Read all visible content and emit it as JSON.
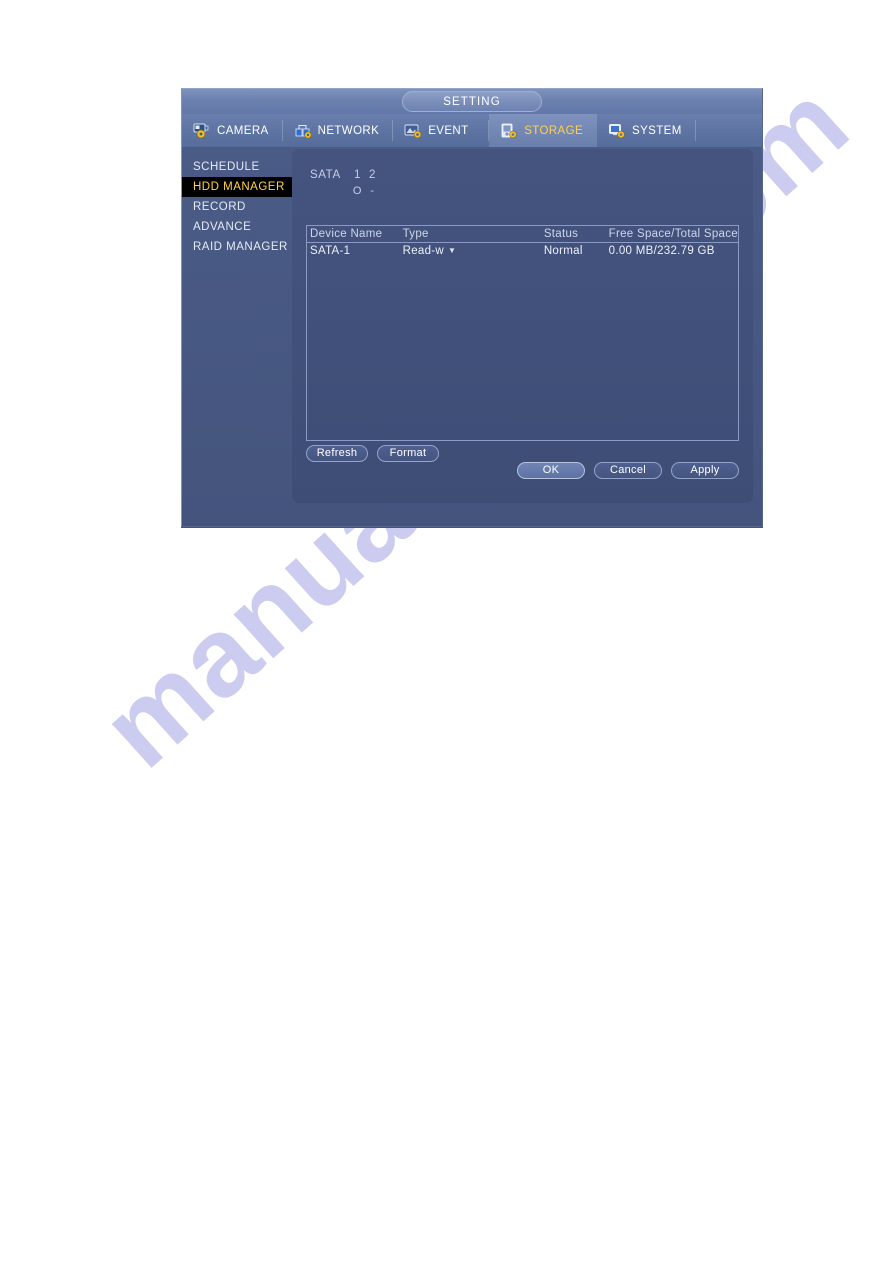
{
  "page": {
    "watermark": "manualshive.com",
    "background_color": "#ffffff",
    "watermark_color": "#c9caf0"
  },
  "dialog": {
    "title": "SETTING",
    "accent_color": "#ffd24d",
    "panel_color": "#3f4f79",
    "chrome_color": "#495a85"
  },
  "tabs": [
    {
      "label": "CAMERA",
      "icon": "camera-gear-icon",
      "active": false
    },
    {
      "label": "NETWORK",
      "icon": "network-gear-icon",
      "active": false
    },
    {
      "label": "EVENT",
      "icon": "event-gear-icon",
      "active": false
    },
    {
      "label": "STORAGE",
      "icon": "storage-gear-icon",
      "active": true
    },
    {
      "label": "SYSTEM",
      "icon": "system-gear-icon",
      "active": false
    }
  ],
  "sidebar": {
    "items": [
      {
        "label": "SCHEDULE",
        "active": false
      },
      {
        "label": "HDD MANAGER",
        "active": true
      },
      {
        "label": "RECORD",
        "active": false
      },
      {
        "label": "ADVANCE",
        "active": false
      },
      {
        "label": "RAID MANAGER",
        "active": false
      }
    ]
  },
  "sata": {
    "label": "SATA",
    "slots": [
      "1",
      "2"
    ],
    "states": [
      "O",
      "-"
    ]
  },
  "table": {
    "headers": [
      "Device Name",
      "Type",
      "Status",
      "Free Space/Total Space"
    ],
    "rows": [
      {
        "device_name": "SATA-1",
        "type": "Read-w",
        "type_caret": "▼",
        "status": "Normal",
        "space": "0.00 MB/232.79 GB"
      }
    ]
  },
  "buttons": {
    "refresh": "Refresh",
    "format": "Format",
    "ok": "OK",
    "cancel": "Cancel",
    "apply": "Apply"
  }
}
